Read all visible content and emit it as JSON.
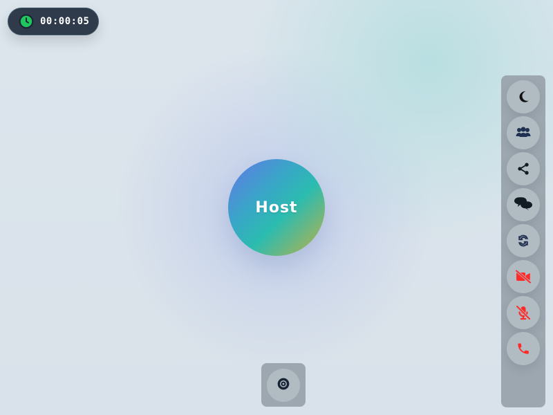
{
  "call": {
    "timer": "00:00:05",
    "participant_label": "Host"
  },
  "controls": {
    "right_panel": [
      {
        "name": "theme-toggle",
        "icon": "moon-icon",
        "color": "#121212"
      },
      {
        "name": "participants",
        "icon": "users-icon",
        "color": "#203050"
      },
      {
        "name": "share",
        "icon": "share-icon",
        "color": "#121a24"
      },
      {
        "name": "chat",
        "icon": "chat-icon",
        "color": "#121a24"
      },
      {
        "name": "switch-camera",
        "icon": "refresh-icon",
        "color": "#203050"
      },
      {
        "name": "camera-toggle",
        "icon": "video-off-icon",
        "color": "#ff2a2a"
      },
      {
        "name": "mic-toggle",
        "icon": "mic-off-icon",
        "color": "#ff2a2a"
      },
      {
        "name": "end-call",
        "icon": "phone-icon",
        "color": "#ff2a2a"
      }
    ],
    "bottom": [
      {
        "name": "record",
        "icon": "record-icon",
        "color": "#162436"
      }
    ]
  },
  "theme": {
    "panel_bg": "#9ca7b0",
    "button_bg": "#b1bbc2",
    "timer_bg": "#2f3b4b",
    "timer_icon_color": "#21c55d",
    "accent_red": "#ff2a2a",
    "host_gradient": [
      "#6477e8",
      "#3aa5c8",
      "#2bbcb0",
      "#c0b043"
    ]
  }
}
